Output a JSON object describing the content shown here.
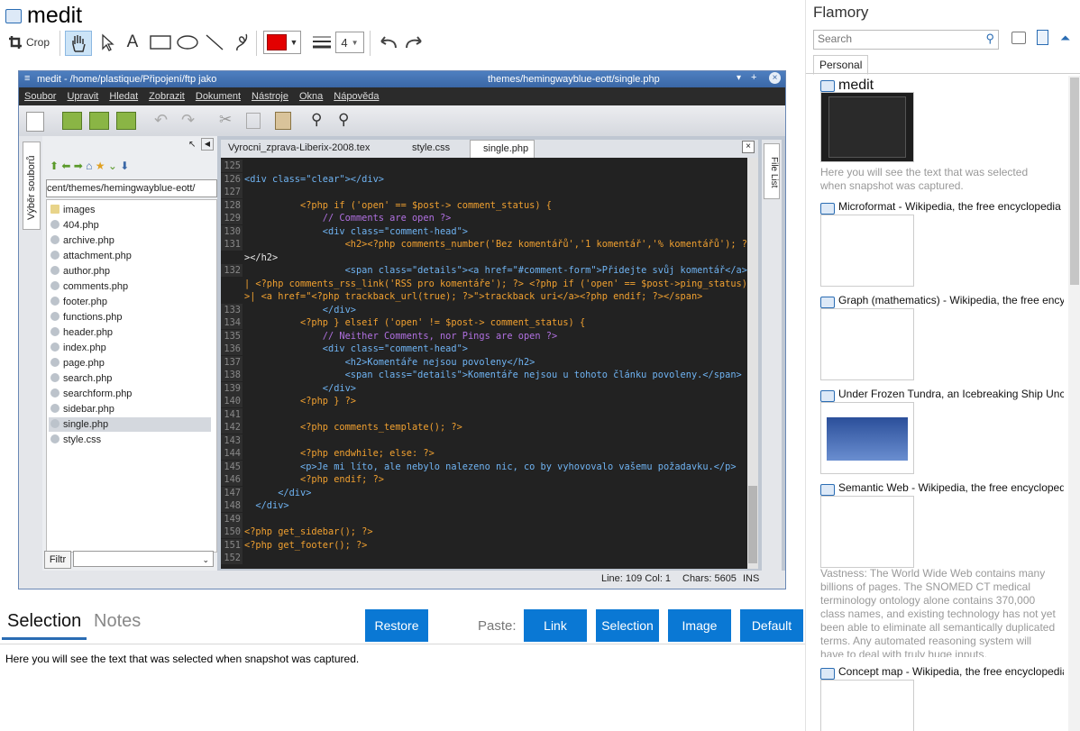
{
  "app": {
    "title": "medit"
  },
  "toolbar": {
    "crop_label": "Crop",
    "line_width": "4",
    "color": "#e30000"
  },
  "editor_screenshot": {
    "window_title": "medit - /home/plastique/Připojení/ftp jako",
    "window_title_right": "themes/hemingwayblue-eott/single.php",
    "menu": [
      "Soubor",
      "Upravit",
      "Hledat",
      "Zobrazit",
      "Dokument",
      "Nástroje",
      "Okna",
      "Nápověda"
    ],
    "side_label": "Výběr souborů",
    "right_side_label": "File List",
    "path": "cent/themes/hemingwayblue-eott/",
    "files": [
      "images",
      "404.php",
      "archive.php",
      "attachment.php",
      "author.php",
      "comments.php",
      "footer.php",
      "functions.php",
      "header.php",
      "index.php",
      "page.php",
      "search.php",
      "searchform.php",
      "sidebar.php",
      "single.php",
      "style.css"
    ],
    "filter_label": "Filtr",
    "tabs": [
      "Vyrocni_zprava-Liberix-2008.tex",
      "style.css",
      "single.php"
    ],
    "code_lines": [
      {
        "n": "125",
        "t": ""
      },
      {
        "n": "126",
        "t": "<div class=\"clear\"></div>"
      },
      {
        "n": "127",
        "t": ""
      },
      {
        "n": "128",
        "t": "          <?php if ('open' == $post-> comment_status) {"
      },
      {
        "n": "129",
        "t": "              // Comments are open ?>"
      },
      {
        "n": "130",
        "t": "              <div class=\"comment-head\">"
      },
      {
        "n": "131",
        "t": "                  <h2><?php comments_number('Bez komentářů','1 komentář','% komentářů'); ?"
      },
      {
        "n": "",
        "t": "></h2>"
      },
      {
        "n": "132",
        "t": "                  <span class=\"details\"><a href=\"#comment-form\">Přidejte svůj komentář</a>"
      },
      {
        "n": "",
        "t": "| <?php comments_rss_link('RSS pro komentáře'); ?> <?php if ('open' == $post->ping_status): ?"
      },
      {
        "n": "",
        "t": ">| <a href=\"<?php trackback_url(true); ?>\">trackback uri</a><?php endif; ?></span>"
      },
      {
        "n": "133",
        "t": "              </div>"
      },
      {
        "n": "134",
        "t": "          <?php } elseif ('open' != $post-> comment_status) {"
      },
      {
        "n": "135",
        "t": "              // Neither Comments, nor Pings are open ?>"
      },
      {
        "n": "136",
        "t": "              <div class=\"comment-head\">"
      },
      {
        "n": "137",
        "t": "                  <h2>Komentáře nejsou povoleny</h2>"
      },
      {
        "n": "138",
        "t": "                  <span class=\"details\">Komentáře nejsou u tohoto článku povoleny.</span>"
      },
      {
        "n": "139",
        "t": "              </div>"
      },
      {
        "n": "140",
        "t": "          <?php } ?>"
      },
      {
        "n": "141",
        "t": ""
      },
      {
        "n": "142",
        "t": "          <?php comments_template(); ?>"
      },
      {
        "n": "143",
        "t": ""
      },
      {
        "n": "144",
        "t": "          <?php endwhile; else: ?>"
      },
      {
        "n": "145",
        "t": "          <p>Je mi líto, ale nebylo nalezeno nic, co by vyhovovalo vašemu požadavku.</p>"
      },
      {
        "n": "146",
        "t": "          <?php endif; ?>"
      },
      {
        "n": "147",
        "t": "      </div>"
      },
      {
        "n": "148",
        "t": "  </div>"
      },
      {
        "n": "149",
        "t": ""
      },
      {
        "n": "150",
        "t": "<?php get_sidebar(); ?>"
      },
      {
        "n": "151",
        "t": "<?php get_footer(); ?>"
      },
      {
        "n": "152",
        "t": ""
      }
    ],
    "status": {
      "line_col": "Line: 109 Col: 1",
      "chars": "Chars: 5605",
      "mode": "INS"
    }
  },
  "bottom": {
    "tab_selection": "Selection",
    "tab_notes": "Notes",
    "restore": "Restore",
    "paste_label": "Paste:",
    "paste_link": "Link",
    "paste_selection": "Selection",
    "paste_image": "Image",
    "paste_default": "Default",
    "selection_text": "Here you will see the text that was selected when snapshot was captured."
  },
  "sidebar": {
    "title": "Flamory",
    "search_placeholder": "Search",
    "tab_personal": "Personal",
    "snapshots": [
      {
        "title": "medit",
        "desc": "Here you will see the text that was selected when snapshot was captured."
      },
      {
        "title": "Microformat - Wikipedia, the free encyclopedia",
        "desc": ""
      },
      {
        "title": "Graph (mathematics) - Wikipedia, the free encyclopedia",
        "desc": ""
      },
      {
        "title": "Under Frozen Tundra, an Icebreaking Ship Uncovers",
        "desc": ""
      },
      {
        "title": "Semantic Web - Wikipedia, the free encyclopedia",
        "desc": "Vastness: The World Wide Web contains many billions of pages. The SNOMED CT medical terminology ontology alone contains 370,000 class names, and existing technology has not yet been able to eliminate all semantically duplicated terms. Any automated reasoning system will have to deal with truly huge inputs."
      },
      {
        "title": "Concept map - Wikipedia, the free encyclopedia",
        "desc": ""
      }
    ]
  },
  "colors": {
    "accent": "#0a78d4",
    "editor_bg": "#222222",
    "keyword": "#f0a030",
    "string": "#7ec94a",
    "tag": "#6fb3f2",
    "comment": "#b070e0"
  }
}
